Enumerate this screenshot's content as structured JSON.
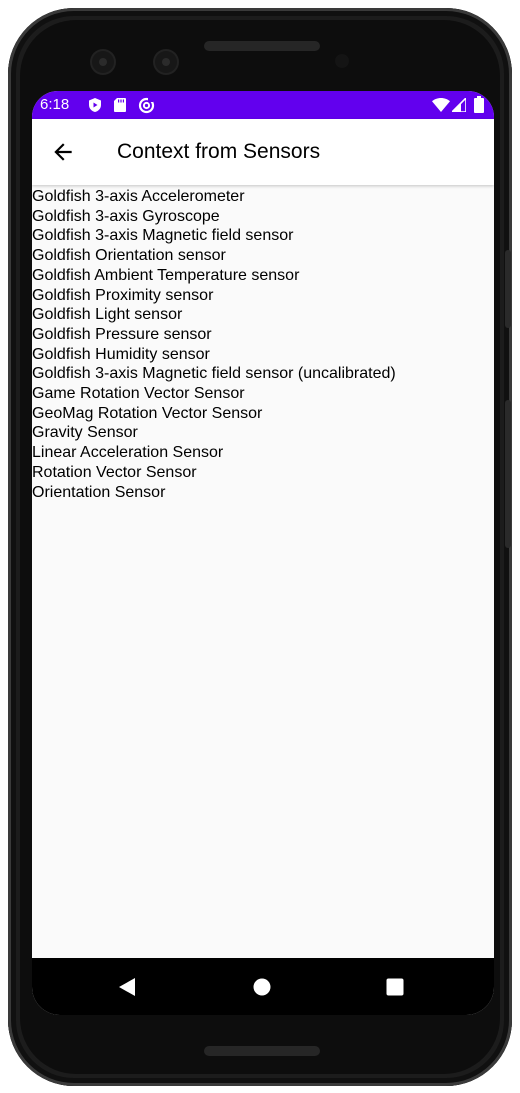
{
  "status_bar": {
    "time": "6:18",
    "color": "#6200ee",
    "icons_left": [
      "play-protect-icon",
      "sd-card-icon",
      "data-saver-icon"
    ],
    "icons_right": [
      "wifi-icon",
      "cell-signal-icon",
      "battery-icon"
    ]
  },
  "app_bar": {
    "title": "Context from Sensors",
    "back_icon": "arrow-back-icon"
  },
  "sensors": [
    "Goldfish 3-axis Accelerometer",
    "Goldfish 3-axis Gyroscope",
    "Goldfish 3-axis Magnetic field sensor",
    "Goldfish Orientation sensor",
    "Goldfish Ambient Temperature sensor",
    "Goldfish Proximity sensor",
    "Goldfish Light sensor",
    "Goldfish Pressure sensor",
    "Goldfish Humidity sensor",
    "Goldfish 3-axis Magnetic field sensor (uncalibrated)",
    "Game Rotation Vector Sensor",
    "GeoMag Rotation Vector Sensor",
    "Gravity Sensor",
    "Linear Acceleration Sensor",
    "Rotation Vector Sensor",
    "Orientation Sensor"
  ],
  "nav_bar": {
    "buttons": [
      "back-triangle-icon",
      "home-circle-icon",
      "recents-square-icon"
    ]
  }
}
